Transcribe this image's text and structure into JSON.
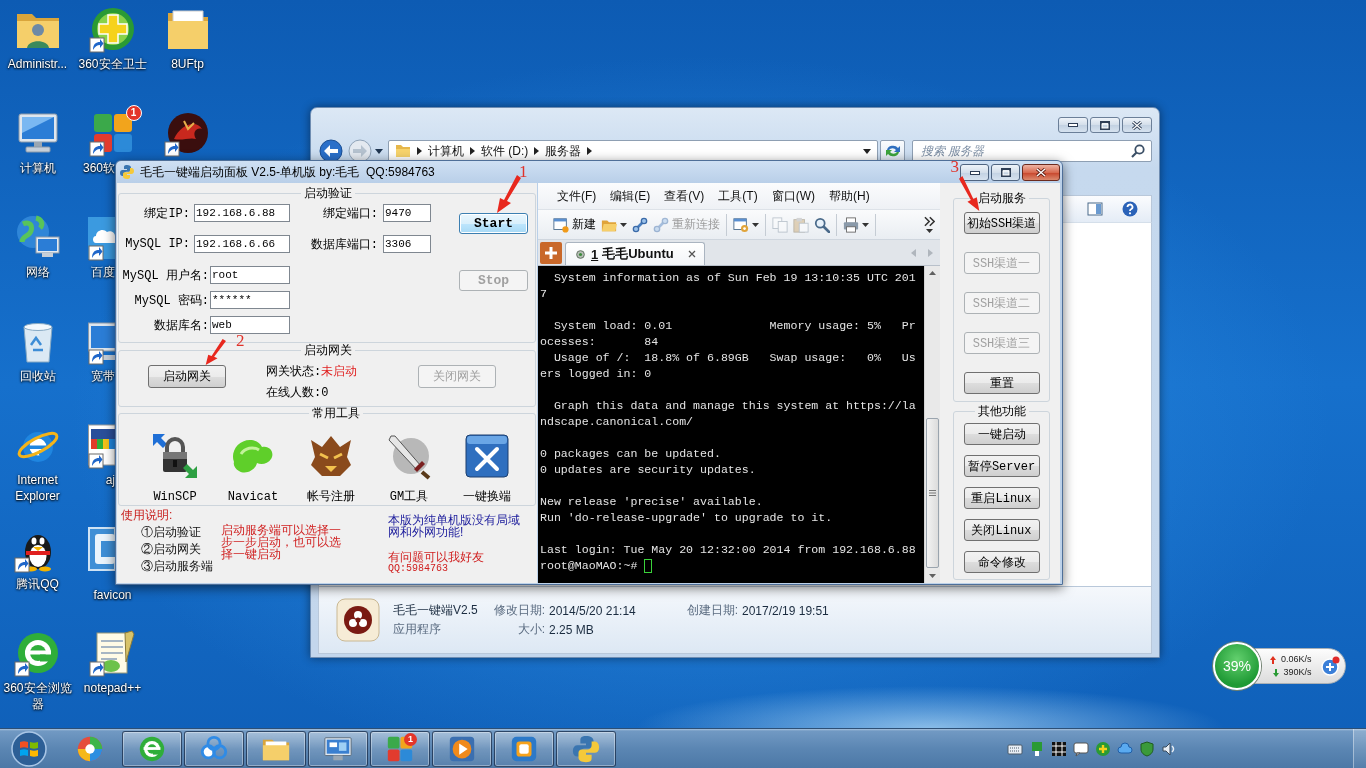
{
  "desktop_icons": [
    {
      "label": "Administr...",
      "kind": "full",
      "shortcut": false
    },
    {
      "label": "计算机",
      "kind": "full",
      "shortcut": false
    },
    {
      "label": "网络",
      "kind": "full",
      "shortcut": false
    },
    {
      "label": "回收站",
      "kind": "full",
      "shortcut": false
    },
    {
      "label": "Internet Explorer",
      "kind": "full",
      "shortcut": false
    },
    {
      "label": "腾讯QQ",
      "kind": "full",
      "shortcut": true
    },
    {
      "label": "360安全浏览器",
      "kind": "full",
      "shortcut": true
    },
    {
      "label": "360安全卫士",
      "kind": "full",
      "shortcut": true
    },
    {
      "label": "360软",
      "kind": "label_cut",
      "shortcut": true,
      "badge": "1"
    },
    {
      "label": "百度",
      "kind": "cut",
      "shortcut": true
    },
    {
      "label": "宽带",
      "kind": "cut",
      "shortcut": true
    },
    {
      "label": "aj",
      "kind": "cut",
      "shortcut": true
    },
    {
      "label": "favicon",
      "kind": "cut_icon",
      "shortcut": false
    },
    {
      "label": "notepad++",
      "kind": "full",
      "shortcut": true
    },
    {
      "label": "8UFtp",
      "kind": "full",
      "shortcut": false
    },
    {
      "kind": "icon_only",
      "shortcut": true
    }
  ],
  "explorer": {
    "breadcrumb": [
      "计算机",
      "软件 (D:)",
      "服务器"
    ],
    "search": {
      "placeholder": "搜索 服务器"
    },
    "details": {
      "name": "毛毛一键端V2.5",
      "type": "应用程序",
      "rows": [
        [
          {
            "label": "修改日期:",
            "value": "2014/5/20 21:14"
          },
          {
            "label": "创建日期:",
            "value": "2017/2/19 19:51"
          }
        ],
        [
          {
            "label": "大小:",
            "value": "2.25 MB"
          }
        ]
      ]
    }
  },
  "app": {
    "title": "毛毛一键端启动面板 V2.5-单机版 by:毛毛  QQ:5984763",
    "verify": {
      "title": "启动验证",
      "rows": [
        [
          {
            "label": "绑定IP:",
            "value": "192.168.6.88"
          },
          {
            "label": "绑定端口:",
            "value": "9470"
          }
        ],
        [
          {
            "label": "MySQL IP:",
            "value": "192.168.6.66"
          },
          {
            "label": "数据库端口:",
            "value": "3306"
          }
        ],
        [
          {
            "label": "MySQL 用户名:",
            "value": "root"
          }
        ],
        [
          {
            "label": "MySQL 密码:",
            "value": "******"
          }
        ],
        [
          {
            "label": "数据库名:",
            "value": "web"
          }
        ]
      ],
      "buttons": [
        {
          "label": "Start",
          "disabled": false,
          "focused": true,
          "annotation": "1"
        },
        {
          "label": "Stop",
          "disabled": true,
          "focused": false
        }
      ]
    },
    "gateway": {
      "title": "启动网关",
      "start_button": {
        "label": "启动网关",
        "disabled": false,
        "annotation": "2"
      },
      "status_label": "网关状态:",
      "status_value": "未启动",
      "running": false,
      "online_label": "在线人数:",
      "online_value": "0",
      "stop_button": {
        "label": "关闭网关",
        "disabled": true
      }
    },
    "tools": {
      "title": "常用工具",
      "items": [
        {
          "label": "WinSCP"
        },
        {
          "label": "Navicat"
        },
        {
          "label": "帐号注册"
        },
        {
          "label": "GM工具"
        },
        {
          "label": "一键换端"
        }
      ]
    },
    "instructions": {
      "title": "使用说明:",
      "steps": [
        "①启动验证",
        "②启动网关",
        "③启动服务端"
      ],
      "note": "启动服务端可以选择一步一步启动，也可以选择一键启动",
      "info": "本版为纯单机版没有局域网和外网功能!",
      "contact": "有问题可以我好友",
      "qq": "QQ:5984763"
    },
    "terminal": {
      "menu": [
        "文件(F)",
        "编辑(E)",
        "查看(V)",
        "工具(T)",
        "窗口(W)",
        "帮助(H)"
      ],
      "toolbar": [
        {
          "kind": "text",
          "label": "新建",
          "disabled": false
        },
        {
          "kind": "menu",
          "disabled": false
        },
        {
          "kind": "icon",
          "disabled": false
        },
        {
          "kind": "text",
          "label": "重新连接",
          "disabled": true
        },
        {
          "kind": "menu",
          "disabled": false
        },
        {
          "kind": "icon",
          "disabled": true
        },
        {
          "kind": "icon",
          "disabled": true
        },
        {
          "kind": "icon",
          "disabled": false
        },
        {
          "kind": "menu",
          "disabled": false
        },
        {
          "kind": "overflow",
          "disabled": false
        }
      ],
      "tabs": [
        {
          "number": "1",
          "label": "毛毛Ubuntu",
          "selected": true
        }
      ],
      "blocks": [
        [
          "  System information as of Sun Feb 19 13:10:35 UTC 201",
          "7"
        ],
        [
          "  System load: 0.01              Memory usage: 5%   Pr",
          "ocesses:       84",
          "  Usage of /:  18.8% of 6.89GB   Swap usage:   0%   Us",
          "ers logged in: 0"
        ],
        [
          "  Graph this data and manage this system at https://la",
          "ndscape.canonical.com/"
        ],
        [
          "0 packages can be updated.",
          "0 updates are security updates."
        ],
        [
          "New release 'precise' available.",
          "Run 'do-release-upgrade' to upgrade to it."
        ],
        [
          "Last login: Tue May 20 12:32:00 2014 from 192.168.6.88"
        ]
      ],
      "prompt": "root@MaoMAO:~#"
    },
    "service_panel": {
      "title": "启动服务",
      "buttons": [
        {
          "label": "初始SSH渠道",
          "disabled": false,
          "annotation": "3"
        },
        {
          "label": "SSH渠道一",
          "disabled": true
        },
        {
          "label": "SSH渠道二",
          "disabled": true
        },
        {
          "label": "SSH渠道三",
          "disabled": true
        },
        {
          "label": "重置",
          "disabled": false
        }
      ]
    },
    "other_panel": {
      "title": "其他功能",
      "buttons": [
        {
          "label": "一键启动",
          "disabled": false
        },
        {
          "label": "暂停Server",
          "disabled": false
        },
        {
          "label": "重启Linux",
          "disabled": false
        },
        {
          "label": "关闭Linux",
          "disabled": false
        },
        {
          "label": "命令修改",
          "disabled": false
        }
      ]
    }
  },
  "speed_widget": {
    "percent": "39%",
    "upload": "0.06K/s",
    "download": "390K/s"
  },
  "taskbar": {
    "apps": [
      {
        "open": false
      },
      {
        "open": true
      },
      {
        "open": true
      },
      {
        "open": true
      },
      {
        "open": true
      },
      {
        "open": true,
        "badge": "1"
      },
      {
        "open": true
      },
      {
        "open": true
      },
      {
        "open": true
      }
    ]
  }
}
